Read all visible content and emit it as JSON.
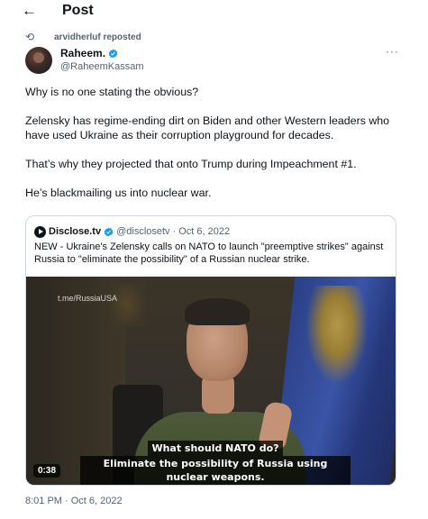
{
  "header": {
    "back_icon": "back-arrow-icon",
    "back_glyph": "←",
    "title": "Post"
  },
  "repost": {
    "icon": "repost-icon",
    "glyph": "⟲",
    "text": "arvidherluf reposted"
  },
  "author": {
    "name": "Raheem.",
    "handle": "@RaheemKassam",
    "verified": true
  },
  "more": "···",
  "tweet": {
    "paragraphs": [
      "Why is no one stating the obvious?",
      "Zelensky has regime-ending dirt on Biden and other Western leaders who have used Ukraine as their corruption playground for decades.",
      "That’s why they projected that onto Trump during Impeachment #1.",
      "He’s blackmailing us into nuclear war."
    ]
  },
  "quote": {
    "name": "Disclose.tv",
    "handle": "@disclosetv",
    "sep": "·",
    "date": "Oct 6, 2022",
    "text": "NEW - Ukraine's Zelensky calls on NATO to launch \"preemptive strikes\" against Russia to \"eliminate the possibility\" of a Russian nuclear strike.",
    "video": {
      "watermark": "t.me/RussiaUSA",
      "subtitle_line1": "What should NATO do?",
      "subtitle_line2": "Eliminate the possibility of Russia using nuclear weapons.",
      "duration": "0:38"
    }
  },
  "timestamp": "8:01 PM · Oct 6, 2022",
  "colors": {
    "text": "#0f1419",
    "muted": "#536471",
    "verified": "#1d9bf0",
    "border": "#cfd9de"
  }
}
